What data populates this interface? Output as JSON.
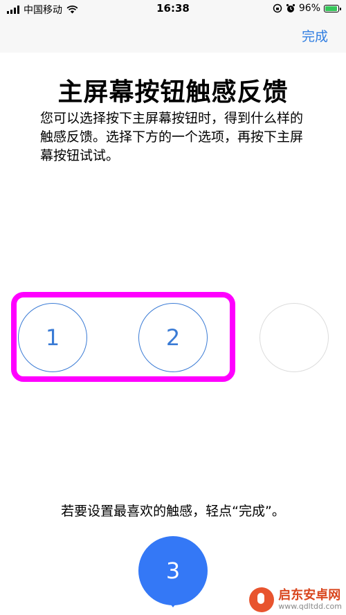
{
  "status_bar": {
    "carrier": "中国移动",
    "time": "16:38",
    "battery_percent": "96%",
    "battery_level": 0.96,
    "icons": [
      "signal-icon",
      "wifi-icon",
      "lock-rotation-icon",
      "alarm-icon",
      "battery-icon"
    ]
  },
  "navbar": {
    "done_label": "完成",
    "accent_color": "#2f7de1"
  },
  "content": {
    "title": "主屏幕按钮触感反馈",
    "description": "您可以选择按下主屏幕按钮时，得到什么样的触感反馈。选择下方的一个选项，再按下主屏幕按钮试试。",
    "options": [
      {
        "label": "1"
      },
      {
        "label": "2"
      },
      {
        "label": ""
      }
    ],
    "selected_option": "3",
    "hint": "若要设置最喜欢的触感，轻点“完成”。"
  },
  "watermark": {
    "name": "启东安卓网",
    "url": "www.qdltdd.com"
  }
}
